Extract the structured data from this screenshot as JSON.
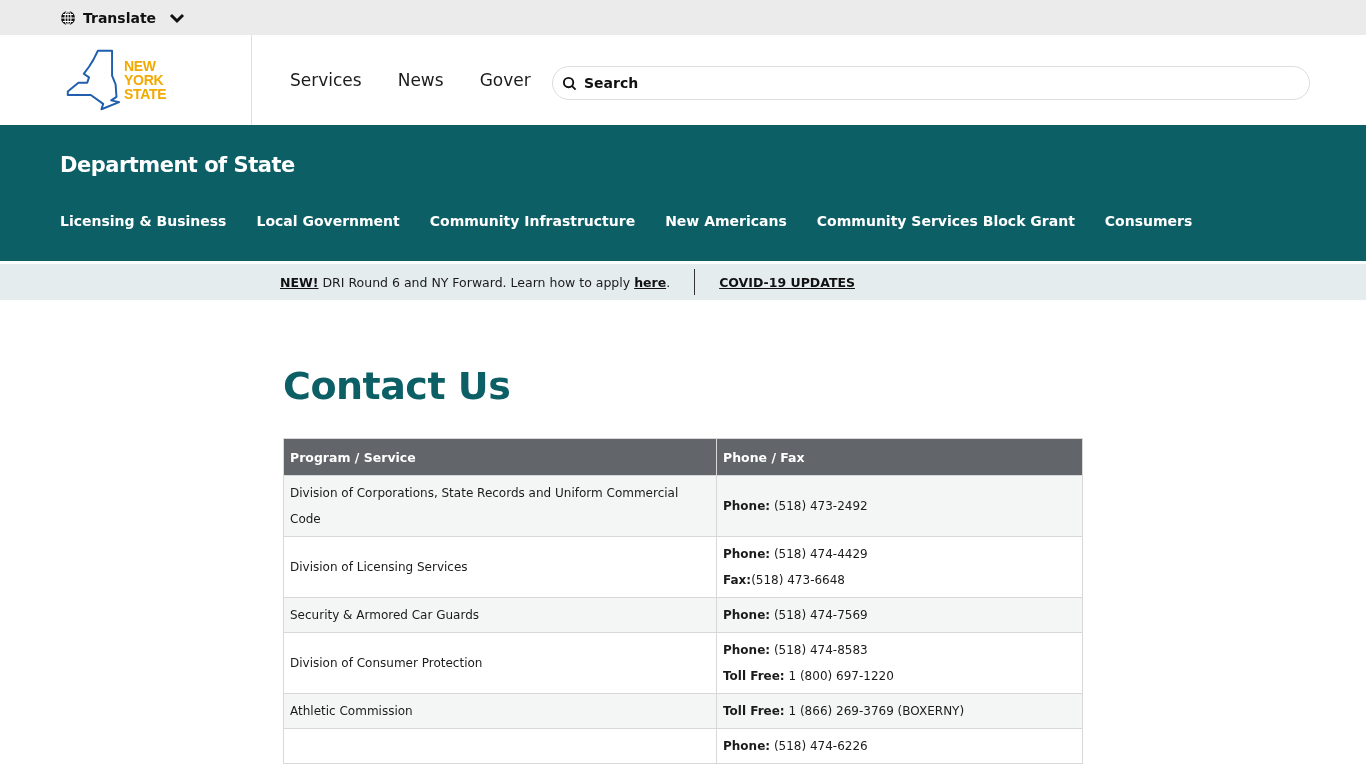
{
  "top_bar": {
    "translate": "Translate"
  },
  "header": {
    "logo_lines": [
      "NEW",
      "YORK",
      "STATE"
    ],
    "nav": [
      "Services",
      "News",
      "Gover"
    ],
    "search": {
      "placeholder": "Search"
    }
  },
  "agency": {
    "title": "Department of State",
    "nav": [
      "Licensing & Business",
      "Local Government",
      "Community Infrastructure",
      "New Americans",
      "Community Services Block Grant",
      "Consumers"
    ]
  },
  "banner": {
    "new_link": "NEW!",
    "text": "DRI Round 6 and NY Forward. Learn how to apply",
    "link": "here",
    "end": ".",
    "updates_link": "COVID-19 UPDATES"
  },
  "page_title": "Contact Us",
  "table": {
    "columns": [
      "Program / Service",
      "Phone / Fax"
    ],
    "rows": [
      {
        "program": "Division of Corporations, State Records and Uniform Commercial Code",
        "contacts": [
          "**Phone:** (518) 473-2492"
        ]
      },
      {
        "program": "Division of Licensing Services",
        "contacts": [
          "**Phone:** (518) 474-4429",
          "**Fax:**(518) 473-6648"
        ]
      },
      {
        "program": "Security & Armored Car Guards",
        "contacts": [
          "**Phone:** (518) 474-7569"
        ]
      },
      {
        "program": "Division of Consumer Protection",
        "contacts": [
          "**Phone:** (518) 474-8583",
          "**Toll Free:** 1 (800) 697-1220"
        ]
      },
      {
        "program": "Athletic Commission",
        "contacts": [
          "**Toll Free:** 1 (866) 269-3769 (BOXERNY)"
        ]
      },
      {
        "contacts": [
          "**Phone:** (518) 474-6226"
        ]
      }
    ]
  }
}
